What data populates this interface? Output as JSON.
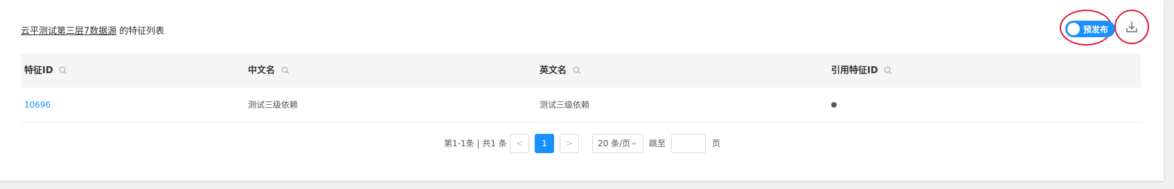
{
  "header": {
    "dataset_link": "云平测试第三层7数据源",
    "title_suffix": "的特征列表",
    "publish_toggle_label": "预发布",
    "publish_toggle_on": true
  },
  "table": {
    "columns": [
      "特征ID",
      "中文名",
      "英文名",
      "引用特征ID"
    ],
    "rows": [
      {
        "feature_id": "10696",
        "cn_name": "测试三级依赖",
        "en_name": "测试三级依赖",
        "ref_feature_id": "•"
      }
    ]
  },
  "pagination": {
    "total_text": "第1-1条 | 共1 条",
    "prev": "<",
    "current_page": "1",
    "next": ">",
    "page_size": "20 条/页",
    "jump_label": "跳至",
    "jump_value": "",
    "page_label": "页"
  },
  "icons": {
    "column_search": "search-icon",
    "download": "download-icon"
  },
  "colors": {
    "accent": "#1890ff",
    "annotation": "#e0192b"
  }
}
